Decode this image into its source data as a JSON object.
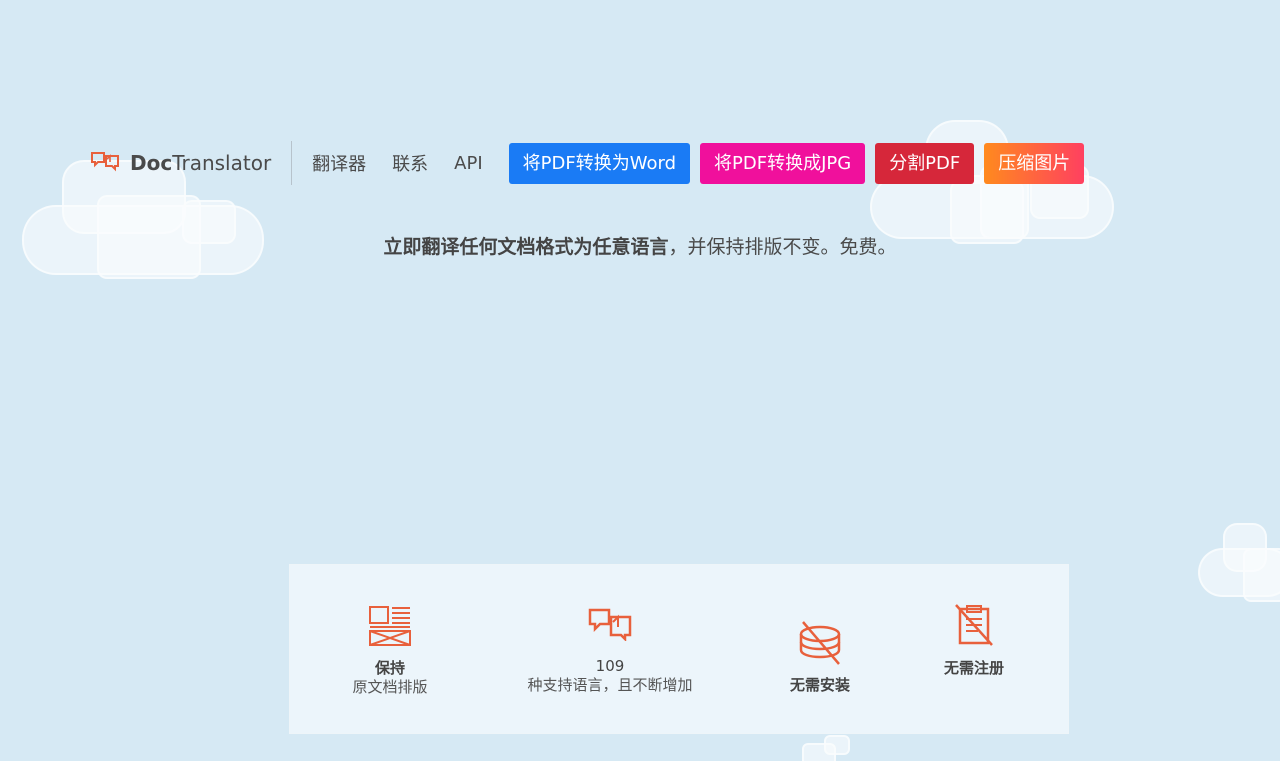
{
  "brand": {
    "bold": "Doc",
    "rest": "Translator"
  },
  "nav": {
    "links": [
      "翻译器",
      "联系",
      "API"
    ]
  },
  "buttons": [
    {
      "label": "将PDF转换为Word",
      "color": "#1a7bf5"
    },
    {
      "label": "将PDF转换成JPG",
      "color": "#f0109c"
    },
    {
      "label": "分割PDF",
      "color": "#d6273a"
    },
    {
      "label": "压缩图片",
      "color": "#ff6a3d"
    }
  ],
  "tagline": {
    "bold": "立即翻译任何文档格式为任意语言",
    "rest": "，并保持排版不变。免费。"
  },
  "features": [
    {
      "title": "保持",
      "subtitle": "原文档排版"
    },
    {
      "title": "109",
      "subtitle": "种支持语言，且不断增加"
    },
    {
      "title": "无需安装",
      "subtitle": ""
    },
    {
      "title": "无需注册",
      "subtitle": ""
    }
  ],
  "colors": {
    "accent": "#e8603c",
    "background": "#d6e9f4"
  }
}
